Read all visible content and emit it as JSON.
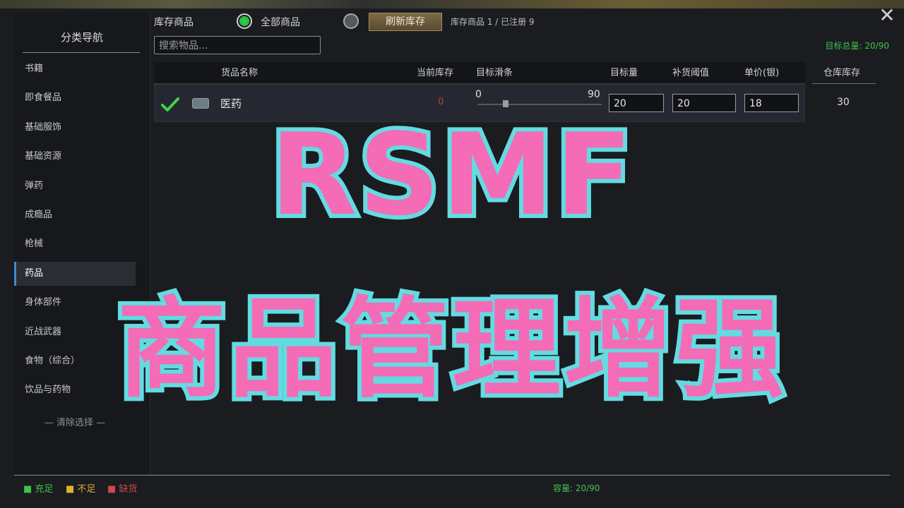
{
  "window": {
    "close_icon": "✕"
  },
  "sidebar": {
    "title": "分类导航",
    "items": [
      {
        "label": "书籍"
      },
      {
        "label": "即食餐品"
      },
      {
        "label": "基础服饰"
      },
      {
        "label": "基础资源"
      },
      {
        "label": "弹药"
      },
      {
        "label": "成瘾品"
      },
      {
        "label": "枪械"
      },
      {
        "label": "药品",
        "active": true
      },
      {
        "label": "身体部件"
      },
      {
        "label": "近战武器"
      },
      {
        "label": "食物（综合）"
      },
      {
        "label": "饮品与药物"
      }
    ],
    "clear_label": "— 清除选择 —"
  },
  "header": {
    "stock_label": "库存商品",
    "all_items_label": "全部商品",
    "refresh_label": "刷新库存",
    "meta": "库存商品 1 / 已注册 9",
    "goal_total": "目标总量: 20/90",
    "search_placeholder": "搜索物品..."
  },
  "table": {
    "columns": [
      "货品名称",
      "当前库存",
      "目标滑条",
      "目标量",
      "补货阈值",
      "单价(银)"
    ],
    "warehouse_column": "仓库库存",
    "rows": [
      {
        "status_icon": "check-icon",
        "item_icon": "medicine-icon",
        "name": "医药",
        "current_stock": "0",
        "slider_min": "0",
        "slider_max": "90",
        "slider_value": 20,
        "target": "20",
        "threshold": "20",
        "price": "18",
        "warehouse": "30"
      }
    ]
  },
  "footer": {
    "legend": [
      {
        "label": "■ 充足",
        "color": "#3ec24a"
      },
      {
        "label": "■ 不足",
        "color": "#e0b030"
      },
      {
        "label": "■ 缺货",
        "color": "#d04848"
      }
    ],
    "capacity": "容量: 20/90"
  },
  "overlay": {
    "line1": "RSMF",
    "line2": "商品管理增强"
  }
}
